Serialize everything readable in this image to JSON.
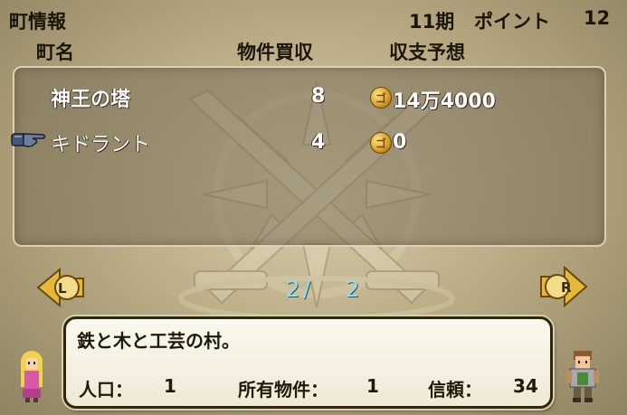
{
  "header": {
    "title": "町情報",
    "period": "11期",
    "points_label": "ポイント",
    "points_value": "12"
  },
  "columns": {
    "town": "町名",
    "purchases": "物件買収",
    "income": "収支予想"
  },
  "towns": [
    {
      "name": "神王の塔",
      "purchases": "8",
      "income": "14万4000",
      "selected": false
    },
    {
      "name": "キドラント",
      "purchases": "4",
      "income": "0",
      "selected": true
    }
  ],
  "pager": {
    "left_label": "L",
    "right_label": "R",
    "current": "2",
    "separator": "/",
    "total": "2"
  },
  "coin_glyph": "ゴ",
  "detail": {
    "description": "鉄と木と工芸の村。",
    "population_label": "人口：",
    "population_value": "1",
    "owned_label": "所有物件：",
    "owned_value": "1",
    "trust_label": "信頼：",
    "trust_value": "34"
  },
  "colors": {
    "accent_gold": "#e0b030",
    "page_text": "#8fdff0",
    "panel_border": "#e6dec4"
  }
}
